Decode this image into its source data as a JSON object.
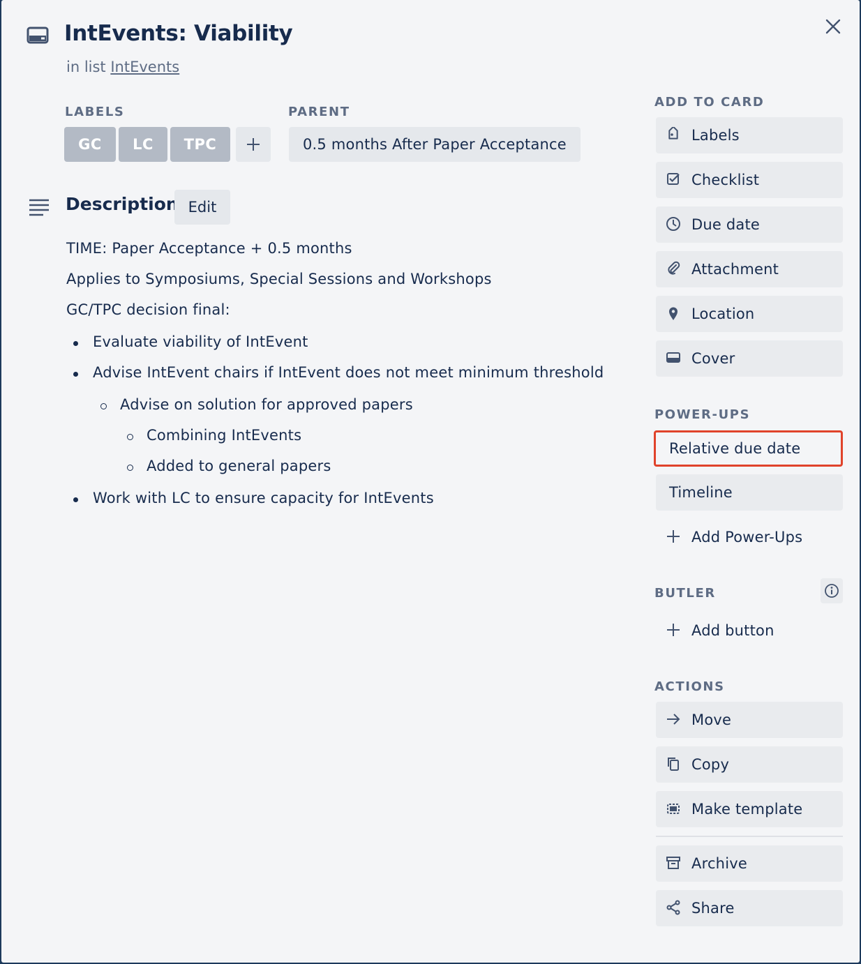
{
  "card": {
    "title": "IntEvents: Viability",
    "in_list_prefix": "in list",
    "list_name": "IntEvents"
  },
  "labels": {
    "heading": "LABELS",
    "items": [
      "GC",
      "LC",
      "TPC"
    ]
  },
  "parent": {
    "heading": "PARENT",
    "value": "0.5 months After Paper Acceptance"
  },
  "description": {
    "heading": "Description",
    "edit_label": "Edit",
    "lines": [
      "TIME: Paper Acceptance + 0.5 months",
      "Applies to Symposiums, Special Sessions and Workshops",
      "GC/TPC decision final:"
    ],
    "bullets": [
      "Evaluate viability of IntEvent",
      "Advise IntEvent chairs if IntEvent does not meet minimum threshold",
      "Advise on solution for approved papers",
      "Combining IntEvents",
      "Added to general papers",
      "Work with LC to ensure capacity for IntEvents"
    ]
  },
  "sidebar": {
    "add_to_card": {
      "heading": "ADD TO CARD",
      "items": [
        "Labels",
        "Checklist",
        "Due date",
        "Attachment",
        "Location",
        "Cover"
      ]
    },
    "power_ups": {
      "heading": "POWER-UPS",
      "items": [
        "Relative due date",
        "Timeline"
      ],
      "add_label": "Add Power-Ups"
    },
    "butler": {
      "heading": "BUTLER",
      "add_button_label": "Add button"
    },
    "actions": {
      "heading": "ACTIONS",
      "items": [
        "Move",
        "Copy",
        "Make template",
        "Archive",
        "Share"
      ]
    }
  },
  "colors": {
    "label_chip": "#b3bac5",
    "button_bg": "#e9ebee",
    "highlight": "#e0432b",
    "text": "#172b4d",
    "muted": "#5e6c84"
  }
}
